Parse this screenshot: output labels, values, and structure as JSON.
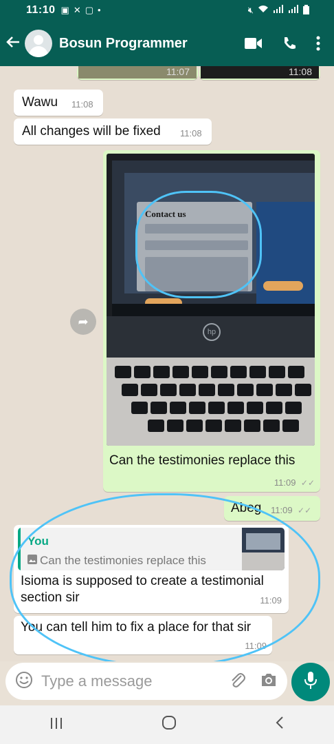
{
  "status_bar": {
    "time": "11:10",
    "left_icons": [
      "image-icon",
      "missed-call-icon",
      "app-icon",
      "dot-icon"
    ],
    "right_icons": [
      "mute-icon",
      "wifi-icon",
      "signal-icon",
      "signal-icon",
      "battery-icon"
    ]
  },
  "header": {
    "contact_name": "Bosun Programmer",
    "actions": [
      "video-call-icon",
      "voice-call-icon",
      "more-options-icon"
    ]
  },
  "messages": [
    {
      "id": "prev-1",
      "type": "image-strip",
      "time": "11:07",
      "direction": "out"
    },
    {
      "id": "prev-2",
      "type": "image-strip",
      "time": "11:08",
      "direction": "out"
    },
    {
      "id": "m1",
      "direction": "in",
      "text": "Wawu",
      "time": "11:08"
    },
    {
      "id": "m2",
      "direction": "in",
      "text": "All changes will be fixed",
      "time": "11:08"
    },
    {
      "id": "m3",
      "direction": "out",
      "type": "image",
      "image_title": "Contact us",
      "caption": "Can the testimonies replace this",
      "time": "11:09"
    },
    {
      "id": "m4",
      "direction": "out",
      "text": "Abeg",
      "time": "11:09"
    },
    {
      "id": "m5",
      "direction": "in",
      "reply_to": {
        "author": "You",
        "quoted_text": "Can the testimonies replace this"
      },
      "text": "Isioma is supposed to create a testimonial section sir",
      "time": "11:09"
    },
    {
      "id": "m6",
      "direction": "in",
      "text": "You can tell him to fix a place for that sir",
      "time": "11:09"
    }
  ],
  "input": {
    "placeholder": "Type a message"
  },
  "colors": {
    "header_bg": "#075e54",
    "outgoing_bubble": "#dcf8c6",
    "incoming_bubble": "#ffffff",
    "accent": "#06a884",
    "mic_button": "#00897b",
    "annotation": "#4fc3f7"
  },
  "nav_icons": [
    "recents-icon",
    "home-icon",
    "back-icon"
  ]
}
